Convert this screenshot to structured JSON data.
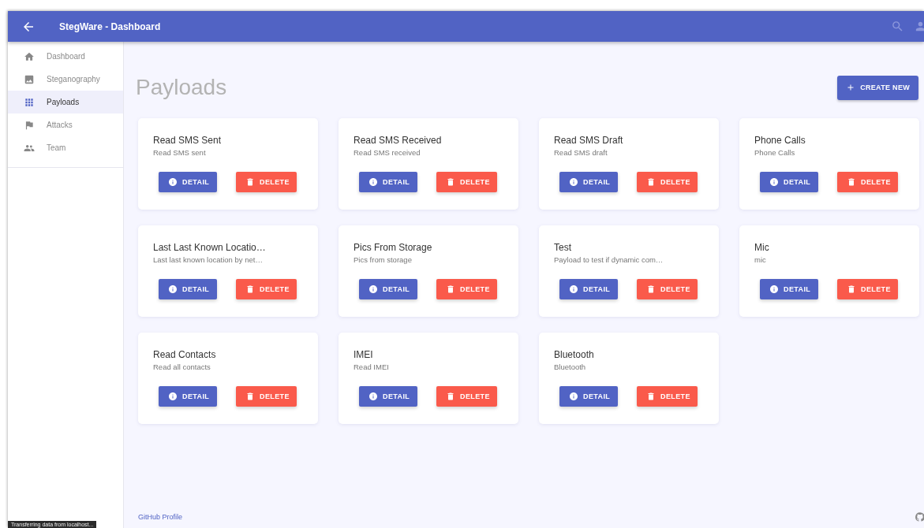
{
  "app_bar": {
    "title": "StegWare - Dashboard"
  },
  "sidebar": {
    "items": [
      {
        "label": "Dashboard",
        "kind": "home",
        "selected": false
      },
      {
        "label": "Steganography",
        "kind": "image",
        "selected": false
      },
      {
        "label": "Payloads",
        "kind": "grid",
        "selected": true
      },
      {
        "label": "Attacks",
        "kind": "flag",
        "selected": false
      },
      {
        "label": "Team",
        "kind": "people",
        "selected": false
      }
    ]
  },
  "page": {
    "title": "Payloads",
    "create_button": "CREATE NEW"
  },
  "payloads": [
    {
      "title": "Read SMS Sent",
      "description": "Read SMS sent",
      "detail": "DETAIL",
      "delete": "DELETE"
    },
    {
      "title": "Read SMS Received",
      "description": "Read SMS received",
      "detail": "DETAIL",
      "delete": "DELETE"
    },
    {
      "title": "Read SMS Draft",
      "description": "Read SMS draft",
      "detail": "DETAIL",
      "delete": "DELETE"
    },
    {
      "title": "Phone Calls",
      "description": "Phone Calls",
      "detail": "DETAIL",
      "delete": "DELETE"
    },
    {
      "title": "Last Last Known Locatio…",
      "description": "Last last known location by net…",
      "detail": "DETAIL",
      "delete": "DELETE"
    },
    {
      "title": "Pics From Storage",
      "description": "Pics from storage",
      "detail": "DETAIL",
      "delete": "DELETE"
    },
    {
      "title": "Test",
      "description": "Payload to test if dynamic com…",
      "detail": "DETAIL",
      "delete": "DELETE"
    },
    {
      "title": "Mic",
      "description": "mic",
      "detail": "DETAIL",
      "delete": "DELETE"
    },
    {
      "title": "Read Contacts",
      "description": "Read all contacts",
      "detail": "DETAIL",
      "delete": "DELETE"
    },
    {
      "title": "IMEI",
      "description": "Read IMEI",
      "detail": "DETAIL",
      "delete": "DELETE"
    },
    {
      "title": "Bluetooth",
      "description": "Bluetooth",
      "detail": "DETAIL",
      "delete": "DELETE"
    }
  ],
  "footer": {
    "link": "GitHub Profile"
  },
  "status_bar": "Transferring data from localhost..."
}
